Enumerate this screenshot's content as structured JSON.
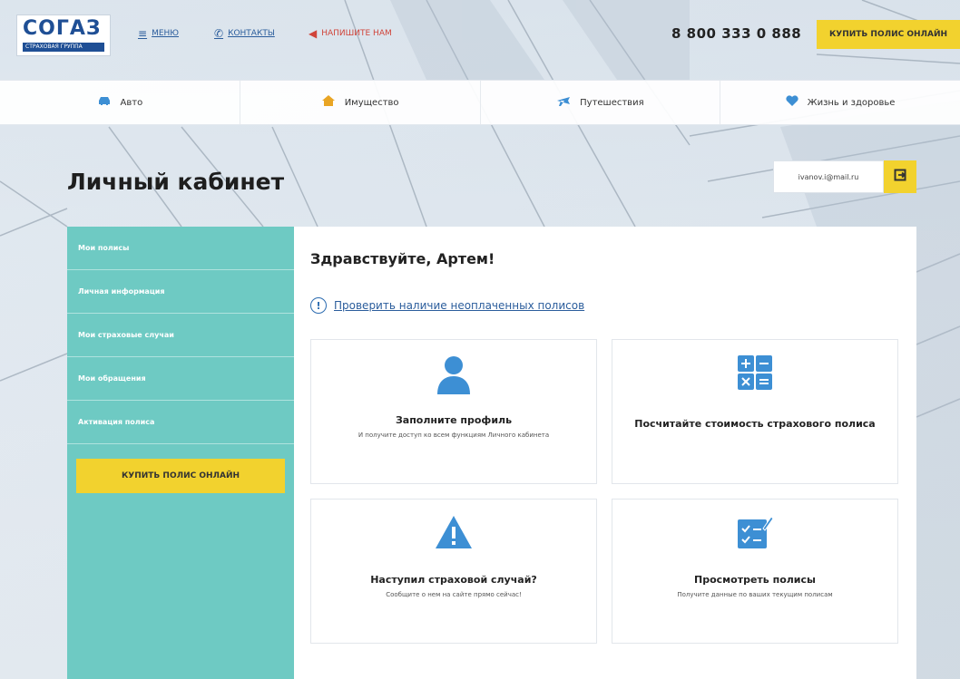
{
  "header": {
    "logo_text": "СОГАЗ",
    "logo_sub": "СТРАХОВАЯ ГРУППА",
    "menu_label": "МЕНЮ",
    "contacts_label": "КОНТАКТЫ",
    "write_label": "НАПИШИТЕ НАМ",
    "phone": "8 800 333 0 888",
    "buy_label": "КУПИТЬ ПОЛИС ОНЛАЙН"
  },
  "categories": [
    {
      "label": "Авто",
      "icon": "car-icon"
    },
    {
      "label": "Имущество",
      "icon": "house-icon"
    },
    {
      "label": "Путешествия",
      "icon": "plane-icon"
    },
    {
      "label": "Жизнь и здоровье",
      "icon": "heart-icon"
    }
  ],
  "page": {
    "title": "Личный кабинет",
    "email": "ivanov.i@mail.ru"
  },
  "sidebar": {
    "items": [
      {
        "label": "Мои полисы"
      },
      {
        "label": "Личная информация"
      },
      {
        "label": "Мои страховые случаи"
      },
      {
        "label": "Мои обращения"
      },
      {
        "label": "Активация полиса"
      }
    ],
    "buy_label": "КУПИТЬ ПОЛИС ОНЛАЙН"
  },
  "main": {
    "greeting": "Здравствуйте, Артем!",
    "check_link": "Проверить наличие неоплаченных полисов",
    "cards": [
      {
        "title": "Заполните профиль",
        "subtitle": "И получите доступ ко всем функциям Личного кабинета",
        "icon": "user-icon"
      },
      {
        "title": "Посчитайте стоимость страхового полиса",
        "subtitle": "",
        "icon": "calculator-icon"
      },
      {
        "title": "Наступил страховой случай?",
        "subtitle": "Сообщите о нем на сайте прямо сейчас!",
        "icon": "warning-icon"
      },
      {
        "title": "Просмотреть полисы",
        "subtitle": "Получите данные по ваших текущим полисам",
        "icon": "checklist-icon"
      }
    ]
  },
  "colors": {
    "accent_yellow": "#f2d22e",
    "sidebar_teal": "#6ecac3",
    "brand_blue": "#1f4f95",
    "icon_blue": "#3d8fd4"
  }
}
